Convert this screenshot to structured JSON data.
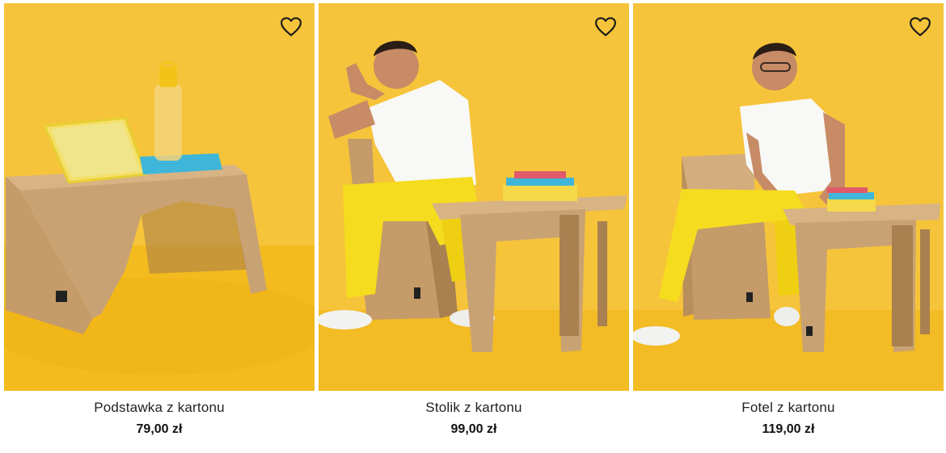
{
  "colors": {
    "background": "#f7c53b",
    "cardboard": "#c9a274",
    "text": "#222222"
  },
  "wishlist_icon": "heart-outline-icon",
  "products": [
    {
      "name": "Podstawka z kartonu",
      "price": "79,00 zł",
      "image": "cardboard-laptop-stand-photo"
    },
    {
      "name": "Stolik z kartonu",
      "price": "99,00 zł",
      "image": "cardboard-side-table-photo"
    },
    {
      "name": "Fotel z kartonu",
      "price": "119,00 zł",
      "image": "cardboard-armchair-photo"
    }
  ]
}
